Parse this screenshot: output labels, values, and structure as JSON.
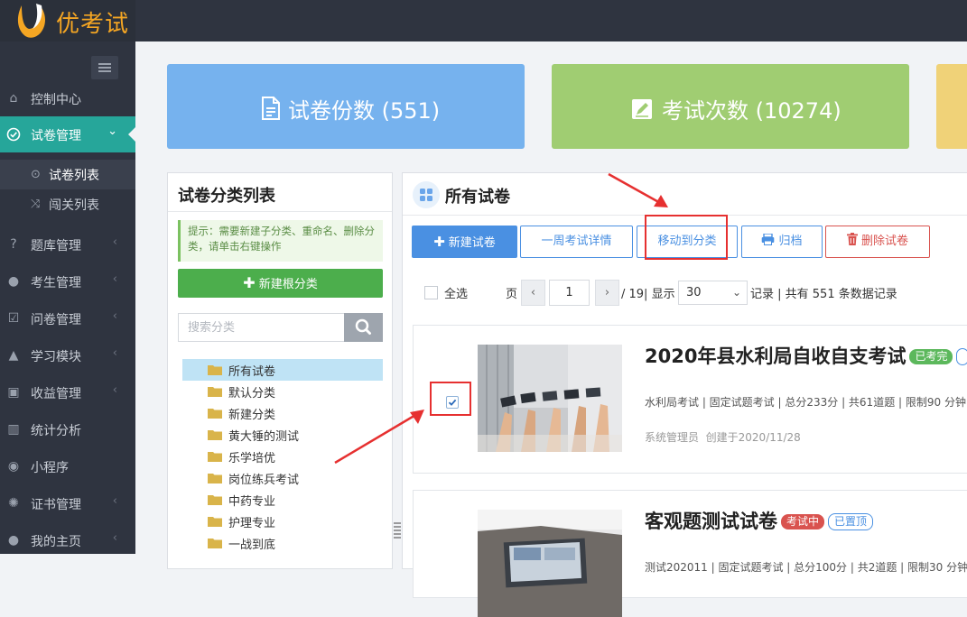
{
  "brand": {
    "name": "优考试",
    "color": "#f5a623"
  },
  "colors": {
    "accent": "#26a69a",
    "sidebar_bg": "#2f3440",
    "primary": "#4a90e2",
    "danger": "#d9534f",
    "success": "#4cae4c",
    "annotation": "#e63030"
  },
  "sidebar": {
    "items": [
      {
        "label": "控制中心",
        "icon": "home-icon"
      },
      {
        "label": "试卷管理",
        "icon": "check-circle-icon",
        "active": true
      },
      {
        "label": "题库管理",
        "icon": "question-circle-icon"
      },
      {
        "label": "考生管理",
        "icon": "user-icon"
      },
      {
        "label": "问卷管理",
        "icon": "check-square-icon"
      },
      {
        "label": "学习模块",
        "icon": "graduation-cap-icon"
      },
      {
        "label": "收益管理",
        "icon": "money-icon"
      },
      {
        "label": "统计分析",
        "icon": "bar-chart-icon"
      },
      {
        "label": "小程序",
        "icon": "wechat-icon"
      },
      {
        "label": "证书管理",
        "icon": "gear-icon"
      },
      {
        "label": "我的主页",
        "icon": "person-icon"
      }
    ],
    "subitems": [
      {
        "label": "试卷列表",
        "icon": "check-circle-icon",
        "selected": true
      },
      {
        "label": "闯关列表",
        "icon": "shuffle-icon"
      }
    ]
  },
  "stats": [
    {
      "label": "试卷份数 (551)",
      "icon": "document-icon",
      "color": "#76b2ee"
    },
    {
      "label": "考试次数 (10274)",
      "icon": "edit-icon",
      "color": "#a0cd72"
    },
    {
      "color": "#f0d278"
    }
  ],
  "category_panel": {
    "title": "试卷分类列表",
    "tip": "提示：需要新建子分类、重命名、删除分类，请单击右键操作",
    "new_root_button": "新建根分类",
    "search_placeholder": "搜索分类",
    "tree": [
      "所有试卷",
      "默认分类",
      "新建分类",
      "黄大锤的测试",
      "乐学培优",
      "岗位练兵考试",
      "中药专业",
      "护理专业",
      "一战到底"
    ]
  },
  "paper_panel": {
    "title": "所有试卷",
    "toolbar": {
      "new_exam": "新建试卷",
      "week_detail": "一周考试详情",
      "move_category": "移动到分类",
      "archive": "归档",
      "delete": "删除试卷"
    },
    "pagination": {
      "select_all": "全选",
      "page_label": "页",
      "current_page": "1",
      "total_pages": "/ 19| 显示",
      "page_size": "30",
      "records_label": "记录 | 共有 551 条数据记录"
    },
    "exams": [
      {
        "title": "2020年县水利局自收自支考试",
        "status": "已考完",
        "meta": "水利局考试 | 固定试题考试 | 总分233分 | 共61道题 | 限制90 分钟",
        "author": "系统管理员",
        "created": "创建于2020/11/28",
        "checked": true
      },
      {
        "title": "客观题测试试卷",
        "status": "考试中",
        "pinned": "已置顶",
        "meta": "测试202011 | 固定试题考试 | 总分100分 | 共2道题 | 限制30 分钟"
      }
    ]
  }
}
